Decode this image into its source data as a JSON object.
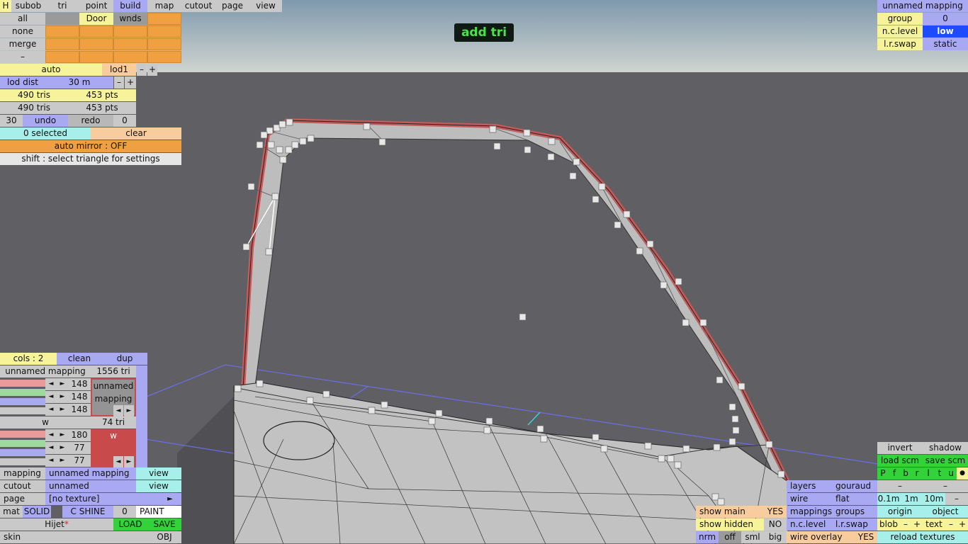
{
  "banner": "add tri",
  "top_bar": {
    "h": "H",
    "subob": "subob",
    "tri": "tri",
    "point": "point",
    "build": "build",
    "map": "map",
    "cutout": "cutout",
    "page": "page",
    "view": "view"
  },
  "subobjects": {
    "all": "all",
    "door": "Door",
    "wnds": "wnds",
    "none": "none",
    "merge": "merge",
    "dash": "–"
  },
  "lod": {
    "auto": "auto",
    "lod1": "lod1",
    "minus": "–",
    "plus": "+",
    "lod_dist": "lod dist",
    "dist_value": "30 m"
  },
  "stats": {
    "tris_a": "490 tris",
    "pts_a": "453 pts",
    "tris_b": "490 tris",
    "pts_b": "453 pts"
  },
  "undo_row": {
    "count": "30",
    "undo": "undo",
    "redo": "redo",
    "redo_count": "0"
  },
  "selection": {
    "selected": "0 selected",
    "clear": "clear",
    "auto_mirror": "auto mirror : OFF",
    "hint": "shift : select triangle for settings"
  },
  "top_right": {
    "mapping": "unnamed mapping",
    "group": "group",
    "group_value": "0",
    "nc_level": "n.c.level",
    "nc_value": "low",
    "lr_swap": "l.r.swap",
    "lr_value": "static"
  },
  "mapping_panel": {
    "cols": "cols : 2",
    "clean": "clean",
    "dup": "dup",
    "mapping_name": "unnamed mapping",
    "tri_count": "1556 tri",
    "rgb": [
      "148",
      "148",
      "148"
    ],
    "preview_name": "unnamed mapping",
    "w_label": "w",
    "w_tri": "74 tri",
    "rgb2": [
      "180",
      "77",
      "77"
    ],
    "preview2": "w",
    "arrow_left": "◄",
    "arrow_right": "►"
  },
  "bottom_left": {
    "mapping": "mapping",
    "mapping_value": "unnamed mapping",
    "view": "view",
    "cutout": "cutout",
    "cutout_value": "unnamed",
    "page": "page",
    "page_value": "[no texture]",
    "page_arrow": "►",
    "mat": "mat",
    "solid": "SOLID",
    "c_shine": "C SHINE",
    "zero": "0",
    "paint": "PAINT",
    "file_name": "Hijet",
    "modified_mark": "*",
    "load": "LOAD",
    "save": "SAVE",
    "skin": "skin",
    "obj": "OBJ"
  },
  "bottom_right": {
    "show_main": "show main",
    "yes": "YES",
    "show_hidden": "show hidden",
    "no": "NO",
    "nrm": "nrm",
    "off": "off",
    "sml": "sml",
    "big": "big",
    "layers": "layers",
    "gouraud": "gouraud",
    "wire": "wire",
    "flat": "flat",
    "mappings": "mappings",
    "groups": "groups",
    "nc_level": "n.c.level",
    "lr_swap": "l.r.swap",
    "wire_overlay": "wire overlay",
    "wire_overlay_value": "YES",
    "invert": "invert",
    "shadow": "shadow",
    "load_scm": "load scm",
    "save_scm": "save scm",
    "views": [
      "P",
      "f",
      "b",
      "r",
      "l",
      "t",
      "u"
    ],
    "dot": "●",
    "dash1": "–",
    "dash2": "–",
    "steps": [
      "0.1m",
      "1m",
      "10m"
    ],
    "step_minus": "–",
    "origin": "origin",
    "object": "object",
    "blob": "blob",
    "text": "text",
    "minus": "–",
    "plus": "+",
    "reload": "reload textures"
  },
  "colors": {
    "sky_top": "#7e99ad",
    "sky_bottom": "#ccd2d0",
    "viewport": "#5f5f64",
    "frame_red": "#c45a5a",
    "mesh": "#c9c9c9",
    "active_blue": "#1d4cff"
  }
}
